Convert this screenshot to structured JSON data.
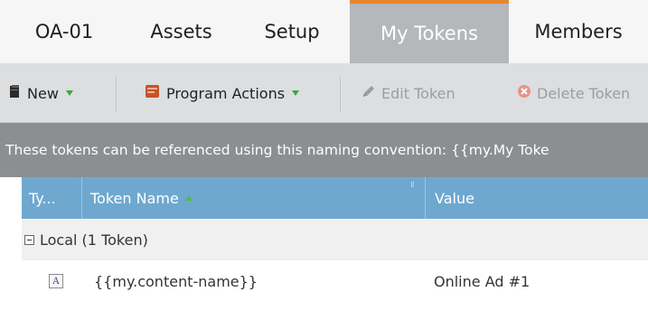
{
  "tabs": [
    {
      "label": "OA-01",
      "active": false
    },
    {
      "label": "Assets",
      "active": false
    },
    {
      "label": "Setup",
      "active": false
    },
    {
      "label": "My Tokens",
      "active": true
    },
    {
      "label": "Members",
      "active": false
    }
  ],
  "toolbar": {
    "new_label": "New",
    "program_actions_label": "Program Actions",
    "edit_token_label": "Edit Token",
    "delete_token_label": "Delete Token"
  },
  "infobar": {
    "text": "These tokens can be referenced using this naming convention: {{my.My Toke"
  },
  "grid": {
    "columns": [
      "Ty...",
      "Token Name",
      "Value"
    ],
    "group": {
      "label": "Local (1 Token)"
    },
    "rows": [
      {
        "type_icon": "text-token-icon",
        "token_name": "{{my.content-name}}",
        "value": "Online Ad #1"
      }
    ]
  },
  "colors": {
    "active_tab_bg": "#b5b7ba",
    "active_tab_accent": "#e8842c",
    "grid_header_bg": "#6ea8cf",
    "caret_green": "#3aa93f"
  }
}
